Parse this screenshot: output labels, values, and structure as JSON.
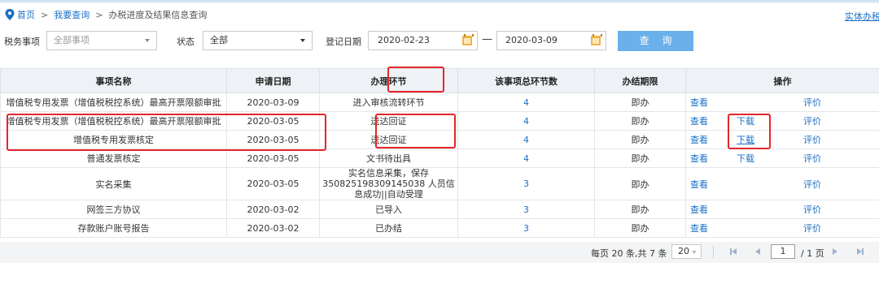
{
  "breadcrumb": {
    "home": "首页",
    "sep1": ">",
    "level2": "我要查询",
    "sep2": ">",
    "current": "办税进度及结果信息查询"
  },
  "topright_link": "实体办税",
  "filters": {
    "tax_item_label": "税务事项",
    "tax_item_placeholder": "全部事项",
    "status_label": "状态",
    "status_value": "全部",
    "date_label": "登记日期",
    "date_from": "2020-02-23",
    "date_sep": "—",
    "date_to": "2020-03-09",
    "query_button": "查 询"
  },
  "table": {
    "headers": [
      "事项名称",
      "申请日期",
      "办理环节",
      "该事项总环节数",
      "办结期限",
      "操作"
    ],
    "rows": [
      {
        "name": "增值税专用发票（增值税税控系统）最高开票限额审批",
        "date": "2020-03-09",
        "stage": "进入审核流转环节",
        "steps": "4",
        "limit": "即办",
        "view": "查看",
        "download": "",
        "rate": "评价"
      },
      {
        "name": "增值税专用发票（增值税税控系统）最高开票限额审批",
        "date": "2020-03-05",
        "stage": "送达回证",
        "steps": "4",
        "limit": "即办",
        "view": "查看",
        "download": "下载",
        "rate": "评价"
      },
      {
        "name": "增值税专用发票核定",
        "date": "2020-03-05",
        "stage": "送达回证",
        "steps": "4",
        "limit": "即办",
        "view": "查看",
        "download": "下载",
        "rate": "评价"
      },
      {
        "name": "普通发票核定",
        "date": "2020-03-05",
        "stage": "文书待出具",
        "steps": "4",
        "limit": "即办",
        "view": "查看",
        "download": "下载",
        "rate": "评价"
      },
      {
        "name": "实名采集",
        "date": "2020-03-05",
        "stage": "实名信息采集，保存 350825198309145038 人员信息成功||自动受理",
        "steps": "3",
        "limit": "即办",
        "view": "查看",
        "download": "",
        "rate": "评价"
      },
      {
        "name": "网签三方协议",
        "date": "2020-03-02",
        "stage": "已导入",
        "steps": "3",
        "limit": "即办",
        "view": "查看",
        "download": "",
        "rate": "评价"
      },
      {
        "name": "存款账户账号报告",
        "date": "2020-03-02",
        "stage": "已办结",
        "steps": "3",
        "limit": "即办",
        "view": "查看",
        "download": "",
        "rate": "评价"
      }
    ]
  },
  "pager": {
    "summary": "每页 20 条,共 7 条",
    "page_size": "20",
    "current_page": "1",
    "total_pages": "/ 1 页"
  },
  "colors": {
    "link": "#1a6fc4",
    "highlight": "#e3262b",
    "button": "#6ab0ea",
    "header_bg": "#eef2f7"
  }
}
